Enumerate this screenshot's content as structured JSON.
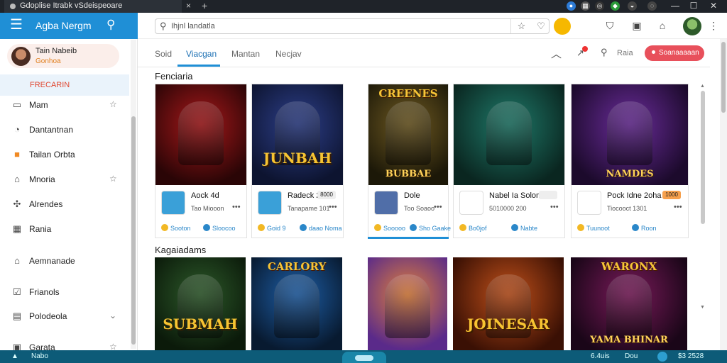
{
  "window": {
    "tab_title": "Gdoplise Itrabk vSdeispeoare",
    "tab_close": "×",
    "new_tab": "+",
    "controls": [
      "—",
      "☐",
      "✕"
    ]
  },
  "sidebar": {
    "brand": "Agba Nergm",
    "profile": {
      "name": "Tain Nabeib",
      "subtitle": "Gonhoa"
    },
    "active_item": "FRECARIN",
    "items": [
      {
        "label": "Mam",
        "icon": "card-icon",
        "glyph": "▭",
        "star": "☆"
      },
      {
        "label": "Dantantnan",
        "icon": "bag-icon",
        "glyph": "◔",
        "star": ""
      },
      {
        "label": "Tailan Orbta",
        "icon": "orange-square-icon",
        "glyph": "■",
        "star": ""
      },
      {
        "label": "Mnoria",
        "icon": "house-icon",
        "glyph": "⌂",
        "star": "☆"
      },
      {
        "label": "Alrendes",
        "icon": "puzzle-icon",
        "glyph": "✣",
        "star": ""
      },
      {
        "label": "Rania",
        "icon": "calendar-icon",
        "glyph": "▦",
        "star": ""
      },
      {
        "label": "Aemnanade",
        "icon": "home-icon",
        "glyph": "⌂",
        "star": ""
      },
      {
        "label": "Frianols",
        "icon": "check-icon",
        "glyph": "☑",
        "star": ""
      },
      {
        "label": "Polodeola",
        "icon": "document-icon",
        "glyph": "▤",
        "star": "⌄"
      },
      {
        "label": "Garata",
        "icon": "gift-icon",
        "glyph": "▣",
        "star": "☆"
      }
    ]
  },
  "toolbar": {
    "search_placeholder": "Ihjnl landatla"
  },
  "tabs": {
    "items": [
      "Soid",
      "Viacgan",
      "Mantan",
      "Necjav"
    ],
    "right_text": "Raia",
    "button_label": "Soanaaaaan"
  },
  "sections": [
    {
      "title": "Fenciaria",
      "cards": [
        {
          "name": "Aock 4d",
          "info": "Tao Miooon",
          "tag": "",
          "foot1": "Sooton",
          "foot2": "Sloocoo",
          "art_top": "",
          "art_main": "",
          "art_sub": "",
          "theme": "#a8181a",
          "theme2": "#2a0506",
          "thumb": "#3aa0d8",
          "tag_bg": "#ffffff"
        },
        {
          "name": "Radeck 2oah",
          "info": "Tanapame 101",
          "tag": "8000",
          "foot1": "Goid 9",
          "foot2": "daao Noma",
          "art_top": "",
          "art_main": "JUNBAH",
          "art_sub": "",
          "theme": "#2d3f8a",
          "theme2": "#0d1430",
          "thumb": "#3aa0d8",
          "tag_bg": "#eeeeee"
        },
        {
          "name": "Dole 1J",
          "info": "Too Soaoo",
          "tag": "",
          "foot1": "Sooooo",
          "foot2": "Sho Gaake",
          "art_top": "CREENES",
          "art_main": "",
          "art_sub": "BUBBAE",
          "theme": "#6f5a22",
          "theme2": "#1c1808",
          "thumb": "#506ea8",
          "tag_bg": "#ffffff"
        },
        {
          "name": "Nabel Ia Solom",
          "info": "5010000 200",
          "tag": "",
          "foot1": "Bo0jof",
          "foot2": "Nabte",
          "art_top": "",
          "art_main": "",
          "art_sub": "",
          "theme": "#1f7a6a",
          "theme2": "#0a2620",
          "thumb": "#ffffff",
          "tag_bg": "#eeeeee"
        },
        {
          "name": "Pock Idne 2oha",
          "info": "Tiocooct 1301",
          "tag": "1000",
          "foot1": "Tuunoot",
          "foot2": "Roon",
          "art_top": "",
          "art_main": "",
          "art_sub": "NAMDES",
          "theme": "#6a2c9a",
          "theme2": "#1c0a2c",
          "thumb": "#ffffff",
          "tag_bg": "#f6a04c"
        }
      ]
    },
    {
      "title": "Kagaiadams",
      "cards": [
        {
          "art_top": "",
          "art_main": "SUBMAH",
          "art_sub": "",
          "theme": "#2d5a2a",
          "theme2": "#0b1a0a"
        },
        {
          "art_top": "CARLORY",
          "art_main": "",
          "art_sub": "",
          "theme": "#1e5fa8",
          "theme2": "#081a30"
        },
        {
          "art_top": "",
          "art_main": "",
          "art_sub": "",
          "theme": "#e0803a",
          "theme2": "#5a2a8a"
        },
        {
          "art_top": "",
          "art_main": "JOINESAR",
          "art_sub": "",
          "theme": "#c0501a",
          "theme2": "#3a1004"
        },
        {
          "art_top": "WARONX",
          "art_main": "",
          "art_sub": "YAMA BHINAR",
          "theme": "#7a1a5a",
          "theme2": "#1a0618"
        }
      ]
    }
  ],
  "taskbar": {
    "left1": "▲",
    "left2": "Nabo",
    "right1": "6.4uis",
    "right2": "Dou",
    "right3": "$3 2528"
  },
  "colors": {
    "accent": "#1f8fd6",
    "danger": "#e8505b",
    "active_text": "#e0462f"
  }
}
